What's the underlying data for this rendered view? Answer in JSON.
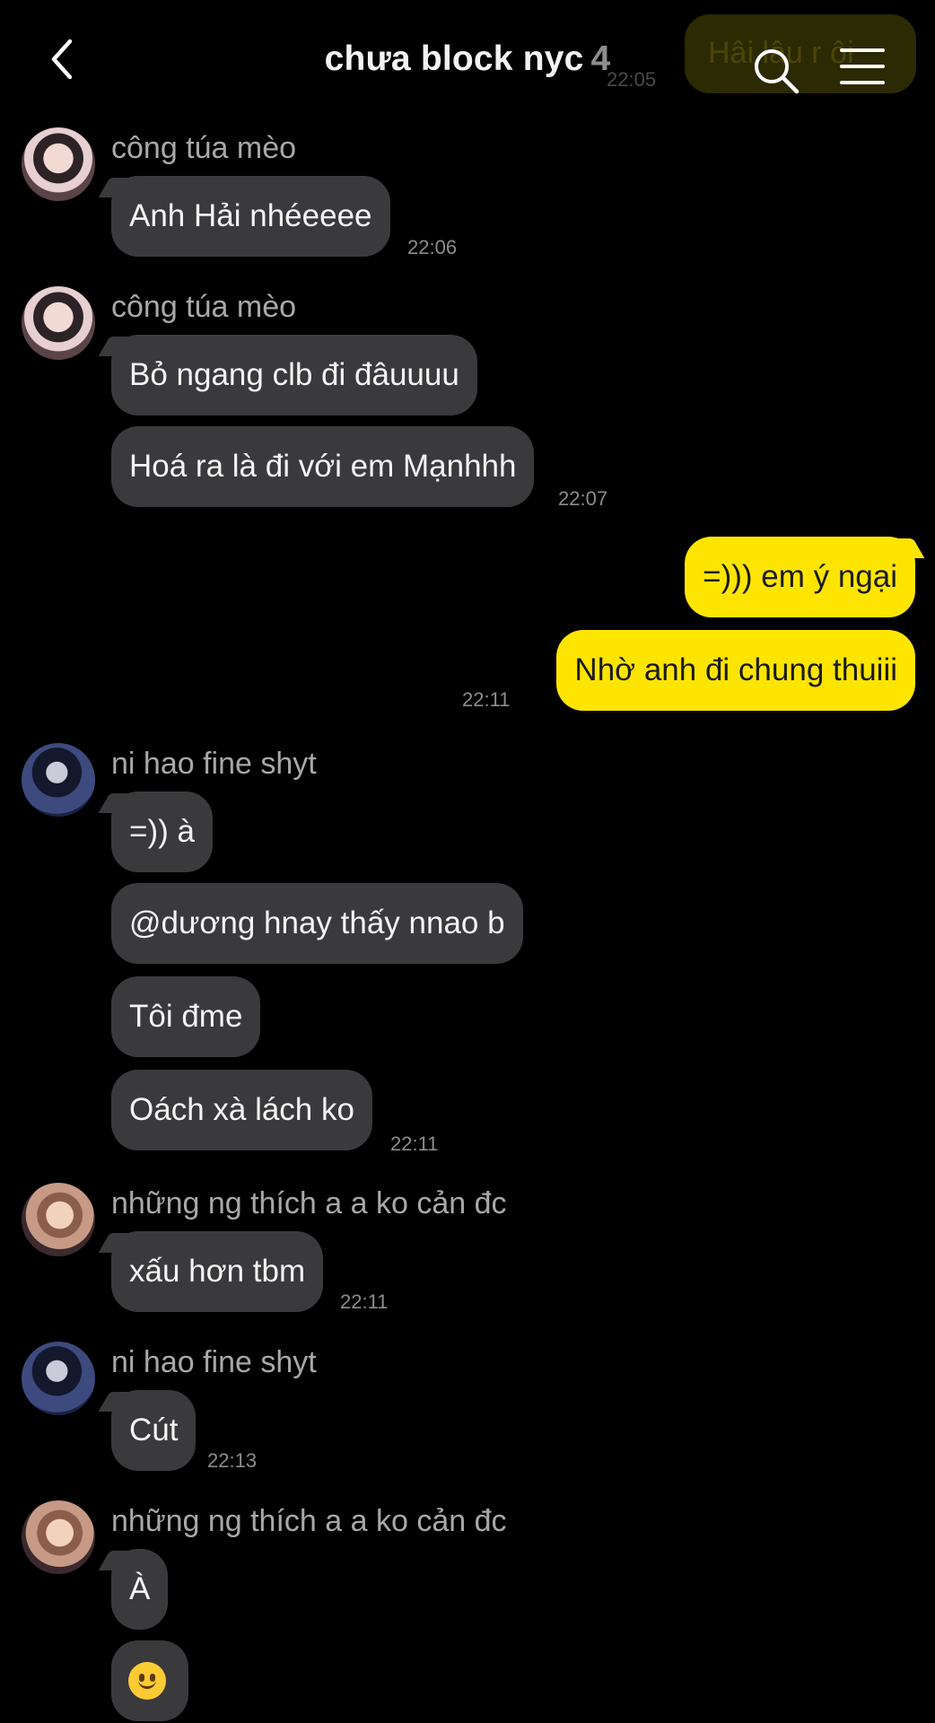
{
  "header": {
    "title": "chưa block nyc",
    "member_count": "4",
    "ghost_message": "Hâi lâu r ôi",
    "ghost_time": "22:05"
  },
  "messages": [
    {
      "sender": "công túa mèo",
      "text": "Anh Hải nhéeeee",
      "time": "22:06"
    },
    {
      "sender": "công túa mèo",
      "text": "Bỏ ngang clb đi đâuuuu"
    },
    {
      "text": "Hoá ra là đi với em Mạnhhh",
      "time": "22:07"
    },
    {
      "text": "=))) em ý ngại"
    },
    {
      "text": "Nhờ anh đi chung thuiii",
      "time": "22:11"
    },
    {
      "sender": "ni hao fine shyt",
      "text": "=)) à"
    },
    {
      "text": "@dương hnay thấy nnao b"
    },
    {
      "text": "Tôi đme"
    },
    {
      "text": "Oách xà lách ko",
      "time": "22:11"
    },
    {
      "sender": "những ng thích a a ko cản đc",
      "text": "xấu hơn tbm",
      "time": "22:11"
    },
    {
      "sender": "ni hao fine shyt",
      "text": "Cút",
      "time": "22:13"
    },
    {
      "sender": "những ng thích a a ko cản đc",
      "text": "À"
    },
    {
      "emoji": "slightly-smiling-face"
    }
  ],
  "colors": {
    "outgoing": "#fee500",
    "incoming": "#3a3a3c",
    "background": "#000000"
  }
}
